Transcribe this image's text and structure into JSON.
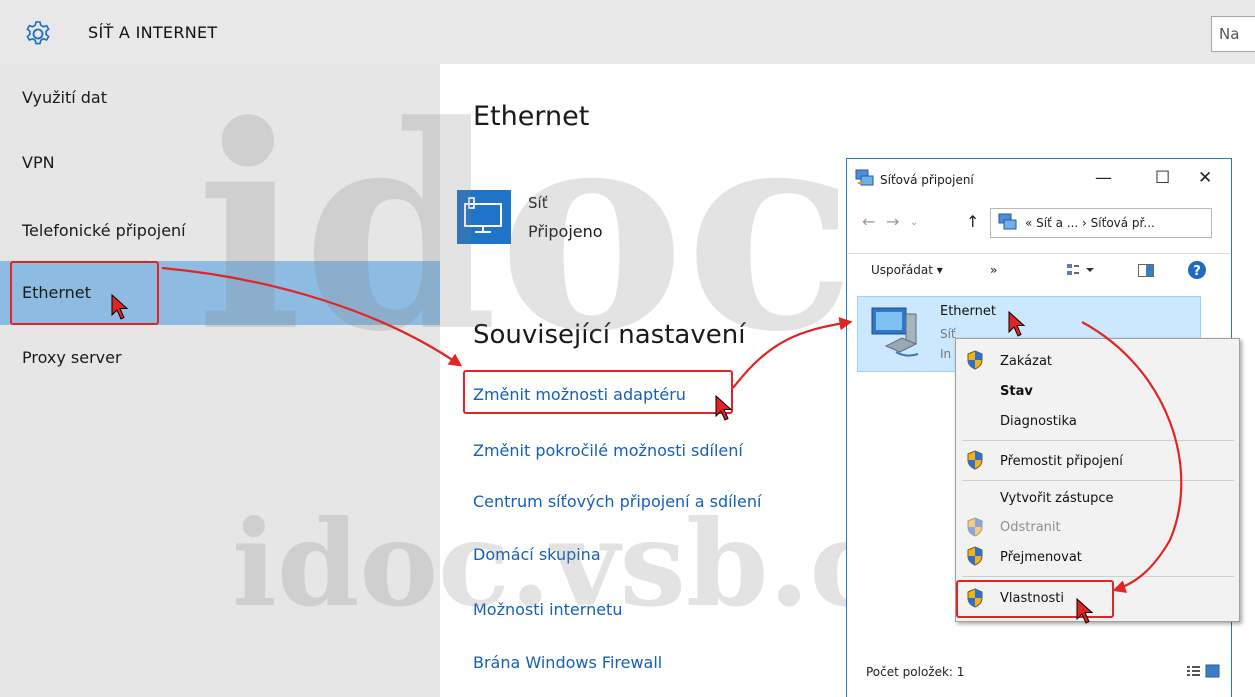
{
  "header": {
    "title": "SÍŤ A INTERNET",
    "search_placeholder": "Na"
  },
  "nav": {
    "items": [
      {
        "label": "Využití dat"
      },
      {
        "label": "VPN"
      },
      {
        "label": "Telefonické připojení"
      },
      {
        "label": "Ethernet"
      },
      {
        "label": "Proxy server"
      }
    ],
    "active_index": 3
  },
  "content": {
    "heading": "Ethernet",
    "network": {
      "name": "Síť",
      "status": "Připojeno"
    },
    "related_heading": "Související nastavení",
    "links": [
      "Změnit možnosti adaptéru",
      "Změnit pokročilé možnosti sdílení",
      "Centrum síťových připojení a sdílení",
      "Domácí skupina",
      "Možnosti internetu",
      "Brána Windows Firewall"
    ]
  },
  "explorer": {
    "title": "Síťová připojení",
    "controls": {
      "minimize": "—",
      "maximize": "☐",
      "close": "✕"
    },
    "address": "« Síť a ...  ›  Síťová př...",
    "toolbar": {
      "organize": "Uspořádat ▾",
      "more": "»"
    },
    "item": {
      "name": "Ethernet",
      "sub1": "Síť",
      "sub2": "In"
    },
    "status": "Počet položek: 1"
  },
  "context_menu": {
    "items": [
      {
        "label": "Zakázat",
        "shield": true
      },
      {
        "label": "Stav",
        "bold": true
      },
      {
        "label": "Diagnostika"
      },
      {
        "label": "Přemostit připojení",
        "shield": true
      },
      {
        "label": "Vytvořit zástupce"
      },
      {
        "label": "Odstranit",
        "shield": true,
        "disabled": true
      },
      {
        "label": "Přejmenovat",
        "shield": true
      },
      {
        "label": "Vlastnosti",
        "shield": true
      }
    ]
  },
  "watermark": {
    "big": "idoc",
    "small": "idoc.vsb.cz"
  },
  "colors": {
    "accent_link": "#1460b6",
    "nav_active": "#8ebbe1",
    "highlight_red": "#e32424",
    "tile_blue": "#1e74c8"
  }
}
